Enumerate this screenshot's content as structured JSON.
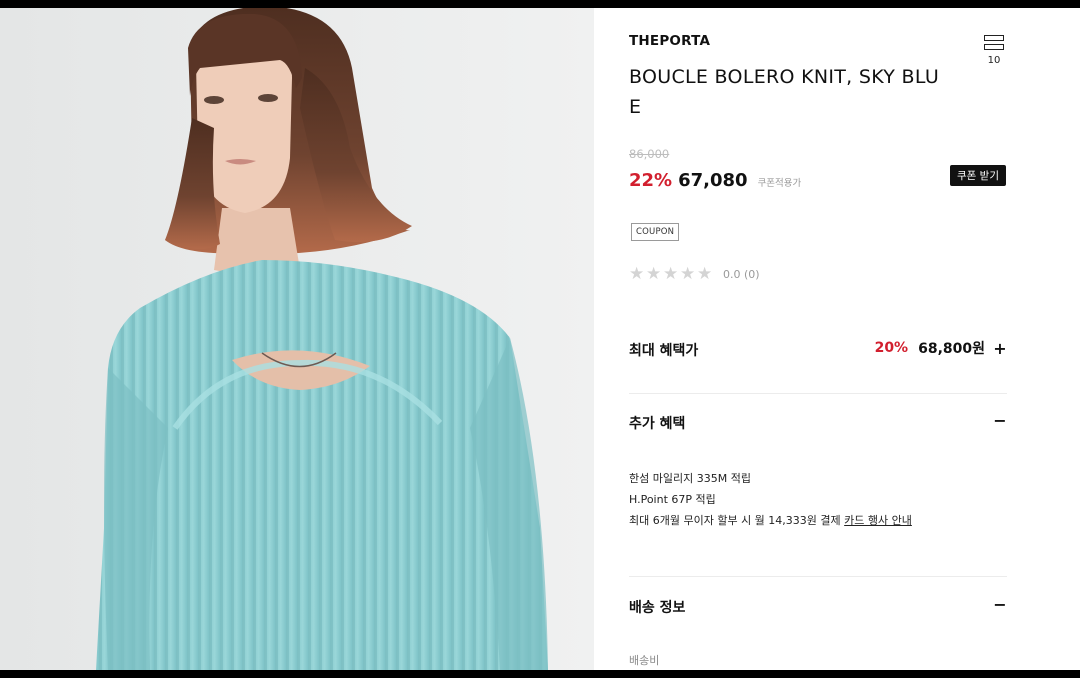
{
  "product": {
    "brand": "THEPORTA",
    "title": "BOUCLE BOLERO KNIT, SKY BLUE",
    "original_price": "86,000",
    "discount": "22%",
    "price": "67,080",
    "price_note": "쿠폰적용가",
    "coupon_button": "쿠폰 받기",
    "coupon_tag": "COUPON",
    "rating_text": "0.0 (0)",
    "rating_value": 0,
    "rating_max": 5
  },
  "menu": {
    "icon": "menu-icon",
    "count": "10"
  },
  "max_benefit": {
    "label": "최대 혜택가",
    "percent": "20%",
    "price": "68,800원",
    "toggle": "+"
  },
  "extra_benefit": {
    "label": "추가 혜택",
    "toggle": "−",
    "lines": [
      "한섬 마일리지 335M 적립",
      "H.Point 67P 적립"
    ],
    "installment_text": "최대 6개월 무이자 할부 시 월 14,333원 결제",
    "card_link": "카드 행사 안내"
  },
  "shipping": {
    "label": "배송 정보",
    "toggle": "−",
    "fee_label": "배송비"
  },
  "colors": {
    "accent": "#d21f2e",
    "knit": "#8ed0d3",
    "hair": "#6b3f2a",
    "background": "#e9eaea"
  }
}
